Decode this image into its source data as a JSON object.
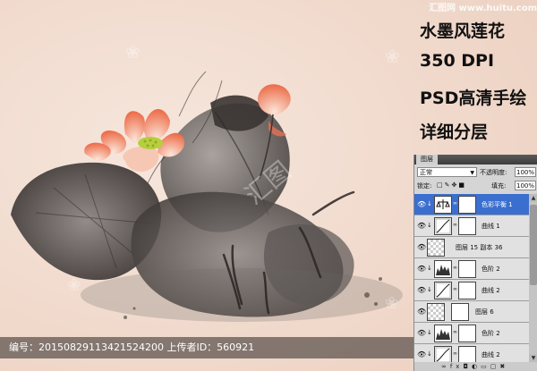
{
  "watermark": {
    "text": "汇图网 www.huitu.com"
  },
  "promo": {
    "lines": [
      "水墨风莲花",
      "350 DPI",
      "PSD高清手绘",
      "详细分层"
    ]
  },
  "layers_panel": {
    "title": "图层",
    "blend_mode": "正常",
    "opacity_label": "不透明度:",
    "opacity_value": "100%",
    "lock_label": "锁定:",
    "fill_label": "填充:",
    "fill_value": "100%",
    "layers": [
      {
        "name": "色彩平衡 1",
        "selected": true,
        "icon": "balance-icon"
      },
      {
        "name": "曲线 1",
        "selected": false,
        "icon": "curves-icon"
      },
      {
        "name": "图层 15 副本 36",
        "selected": false,
        "icon": "pattern-icon"
      },
      {
        "name": "色阶 2",
        "selected": false,
        "icon": "levels-icon"
      },
      {
        "name": "曲线 2",
        "selected": false,
        "icon": "curves-icon"
      },
      {
        "name": "图层 6",
        "selected": false,
        "icon": "checker-icon"
      },
      {
        "name": "色阶 2",
        "selected": false,
        "icon": "levels-icon"
      },
      {
        "name": "曲线 2",
        "selected": false,
        "icon": "curves-icon"
      }
    ]
  },
  "infobar": {
    "text": "编号：20150829113421524200 上传者ID：560921"
  },
  "colors": {
    "background": "#f1dccf",
    "ink": "#3b3533",
    "lotus": "#ef7b5c",
    "selected_layer": "#3b6fcf"
  }
}
